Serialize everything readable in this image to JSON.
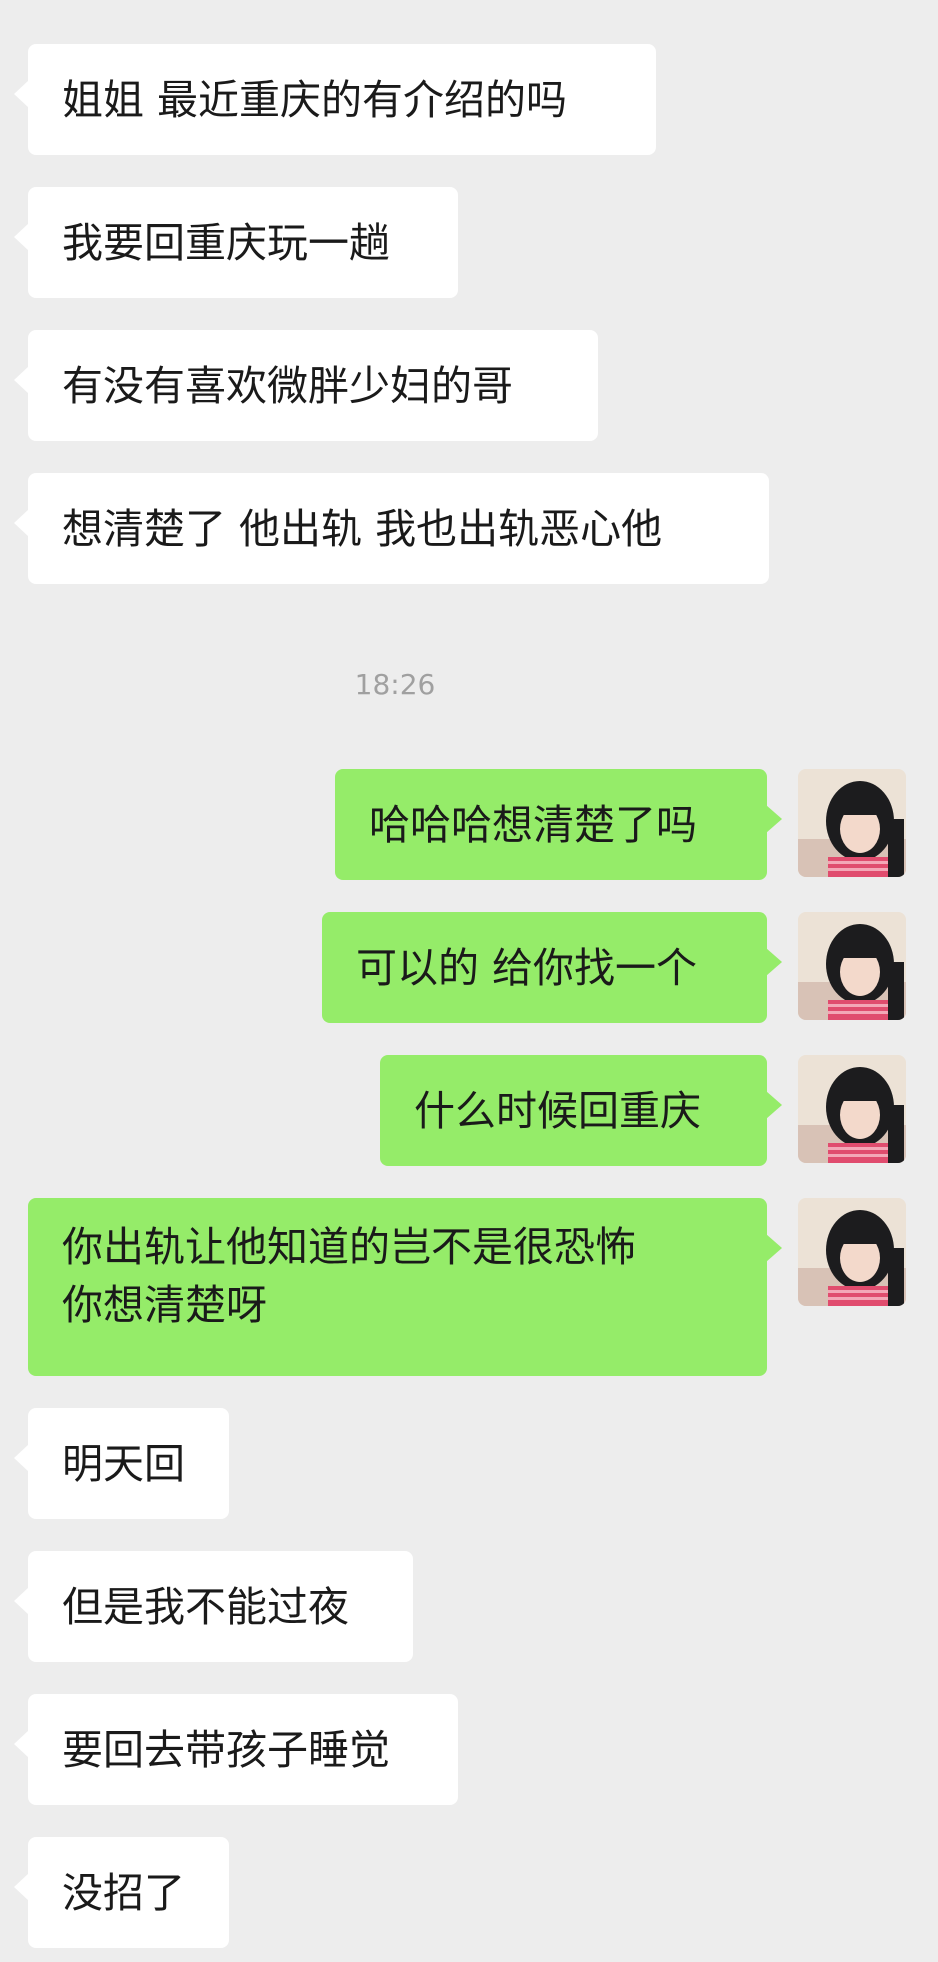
{
  "chat": {
    "timestamp": "18:26",
    "messages": [
      {
        "side": "in",
        "text": "姐姐 最近重庆的有介绍的吗"
      },
      {
        "side": "in",
        "text": "我要回重庆玩一趟"
      },
      {
        "side": "in",
        "text": "有没有喜欢微胖少妇的哥"
      },
      {
        "side": "in",
        "text": "想清楚了 他出轨 我也出轨恶心他"
      },
      {
        "side": "out",
        "text": "哈哈哈想清楚了吗"
      },
      {
        "side": "out",
        "text": "可以的 给你找一个"
      },
      {
        "side": "out",
        "text": "什么时候回重庆"
      },
      {
        "side": "out",
        "lines": [
          "你出轨让他知道的岂不是很恐怖",
          "你想清楚呀"
        ]
      },
      {
        "side": "in",
        "text": "明天回"
      },
      {
        "side": "in",
        "text": "但是我不能过夜"
      },
      {
        "side": "in",
        "text": "要回去带孩子睡觉"
      },
      {
        "side": "in",
        "text": "没招了"
      }
    ]
  }
}
